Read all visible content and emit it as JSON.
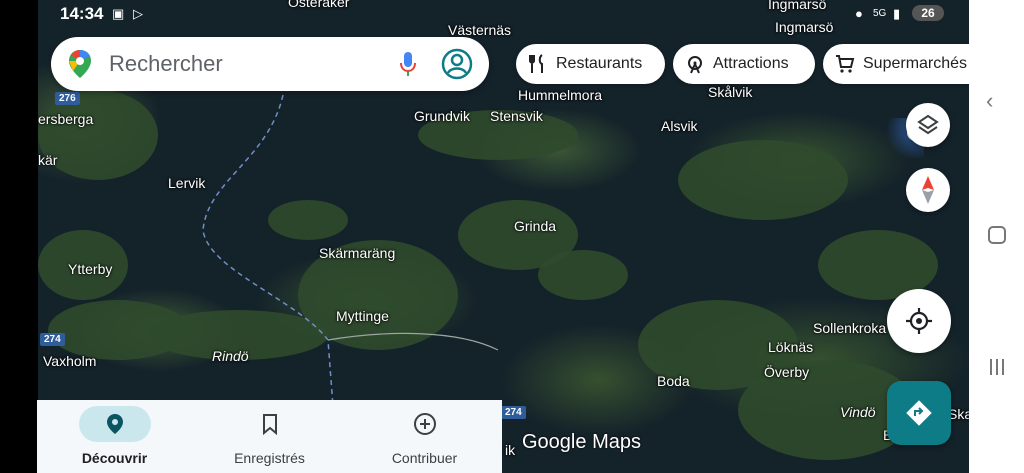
{
  "status_bar": {
    "time": "14:34",
    "battery": "26",
    "signal_text": "5G"
  },
  "search": {
    "placeholder": "Rechercher"
  },
  "chips": [
    {
      "label": "Restaurants",
      "icon": "fork-knife-icon"
    },
    {
      "label": "Attractions",
      "icon": "ferris-wheel-icon"
    },
    {
      "label": "Supermarchés",
      "icon": "cart-icon"
    }
  ],
  "map_labels": {
    "osteraker": "Österåker",
    "vasternas": "Västernäs",
    "ingmarso_top": "Ingmarsö",
    "ingmarso": "Ingmarsö",
    "hummelmora": "Hummelmora",
    "skalvik": "Skålvik",
    "ersberga": "ersberga",
    "grundvik": "Grundvik",
    "stensvik": "Stensvik",
    "alsvik": "Alsvik",
    "kar": "kär",
    "lervik": "Lervik",
    "grinda": "Grinda",
    "skarmarang": "Skärmaräng",
    "ytterby": "Ytterby",
    "myttinge": "Myttinge",
    "sollenkroka": "Sollenkroka",
    "vaxholm": "Vaxholm",
    "rindo": "Rindö",
    "loknas": "Löknäs",
    "overby": "Överby",
    "boda": "Boda",
    "vindo": "Vindö",
    "ska": "Ska",
    "ik": "ik",
    "b": "B"
  },
  "road_shields": {
    "r276": "276",
    "r274": "274",
    "r274b": "274"
  },
  "brand": {
    "google": "Google",
    "maps": "Maps"
  },
  "bottom_nav": [
    {
      "label": "Découvrir",
      "icon": "location-pin-icon",
      "active": true
    },
    {
      "label": "Enregistrés",
      "icon": "bookmark-icon",
      "active": false
    },
    {
      "label": "Contribuer",
      "icon": "add-circle-icon",
      "active": false
    }
  ],
  "colors": {
    "accent_teal": "#0e7c86",
    "active_pill": "#cbe7ee",
    "map_water": "#14222a"
  }
}
